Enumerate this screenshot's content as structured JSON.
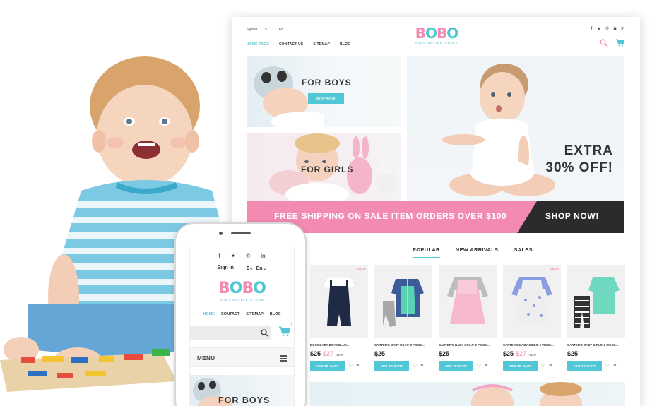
{
  "desktop": {
    "top": {
      "sign_in": "Sign in",
      "currency": "$",
      "language": "En"
    },
    "nav": [
      {
        "label": "HOME PAGE",
        "active": true
      },
      {
        "label": "CONTACT US",
        "active": false
      },
      {
        "label": "SITEMAP",
        "active": false
      },
      {
        "label": "BLOG",
        "active": false
      }
    ],
    "logo": {
      "text": "BOBO",
      "subtitle": "BABY ONLINE STORE"
    },
    "social_icons": [
      "facebook-icon",
      "twitter-icon",
      "pinterest-icon",
      "instagram-icon",
      "linkedin-icon"
    ],
    "banners": {
      "boys": {
        "title": "FOR BOYS",
        "button": "SHOP NOW!"
      },
      "girls": {
        "title": "FOR GIRLS"
      },
      "slider": {
        "line1": "EXTRA",
        "line2": "30% OFF!"
      }
    },
    "shipping": {
      "text": "FREE SHIPPING ON SALE ITEM ORDERS OVER $100",
      "button": "SHOP NOW!"
    },
    "tabs": [
      {
        "label": "POPULAR",
        "active": true
      },
      {
        "label": "NEW ARRIVALS",
        "active": false
      },
      {
        "label": "SALES",
        "active": false
      }
    ],
    "products": [
      {
        "name": "BOSS BABY BOYS BLUE...",
        "price": "$25",
        "old_price": "$27",
        "discount": "-10%",
        "sale": "SALE!",
        "button": "ADD TO CART"
      },
      {
        "name": "CARTER'S BABY BOYS' 3 PIECE...",
        "price": "$25",
        "old_price": "",
        "discount": "",
        "sale": "",
        "button": "ADD TO CART"
      },
      {
        "name": "CARTER'S BABY GIRLS' 2 PIECE...",
        "price": "$25",
        "old_price": "",
        "discount": "",
        "sale": "",
        "button": "ADD TO CART"
      },
      {
        "name": "CARTER'S BABY GIRLS' 2 PIECE...",
        "price": "$25",
        "old_price": "$27",
        "discount": "-10%",
        "sale": "SALE!",
        "button": "ADD TO CART"
      },
      {
        "name": "CARTER'S BABY GIRLS' 2-PIECE...",
        "price": "$25",
        "old_price": "",
        "discount": "",
        "sale": "",
        "button": "ADD TO CART"
      }
    ]
  },
  "phone": {
    "sign_in": "Sign in",
    "currency": "$",
    "language": "En",
    "logo": {
      "text": "BOBO",
      "subtitle": "BABY ONLINE STORE"
    },
    "nav": [
      "HOME",
      "CONTACT",
      "SITEMAP",
      "BLOG"
    ],
    "cart_count": "0",
    "menu_label": "MENU",
    "banner_title": "FOR BOYS"
  },
  "colors": {
    "accent": "#51c6d4",
    "pink": "#f28ab2",
    "dark": "#2b2b2b"
  }
}
